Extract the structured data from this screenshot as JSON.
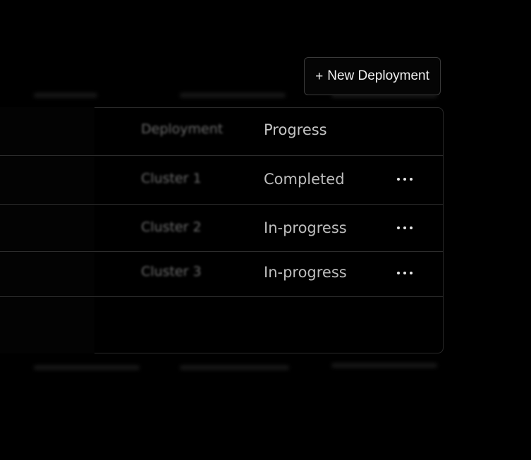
{
  "toolbar": {
    "new_button_icon": "+",
    "new_button_label": "New Deployment"
  },
  "table": {
    "headers": {
      "deployment": "Deployment",
      "progress": "Progress"
    },
    "rows": [
      {
        "deployment": "Cluster 1",
        "progress": "Completed",
        "more_icon": "more-horizontal-icon"
      },
      {
        "deployment": "Cluster 2",
        "progress": "In-progress",
        "more_icon": "more-horizontal-icon"
      },
      {
        "deployment": "Cluster 3",
        "progress": "In-progress",
        "more_icon": "more-horizontal-icon"
      }
    ]
  },
  "colors": {
    "background": "#000000",
    "border": "#2c2c2c",
    "text_primary": "#f2f2f2",
    "text_secondary": "#bdbdbd",
    "text_muted": "#6a6a6a"
  }
}
